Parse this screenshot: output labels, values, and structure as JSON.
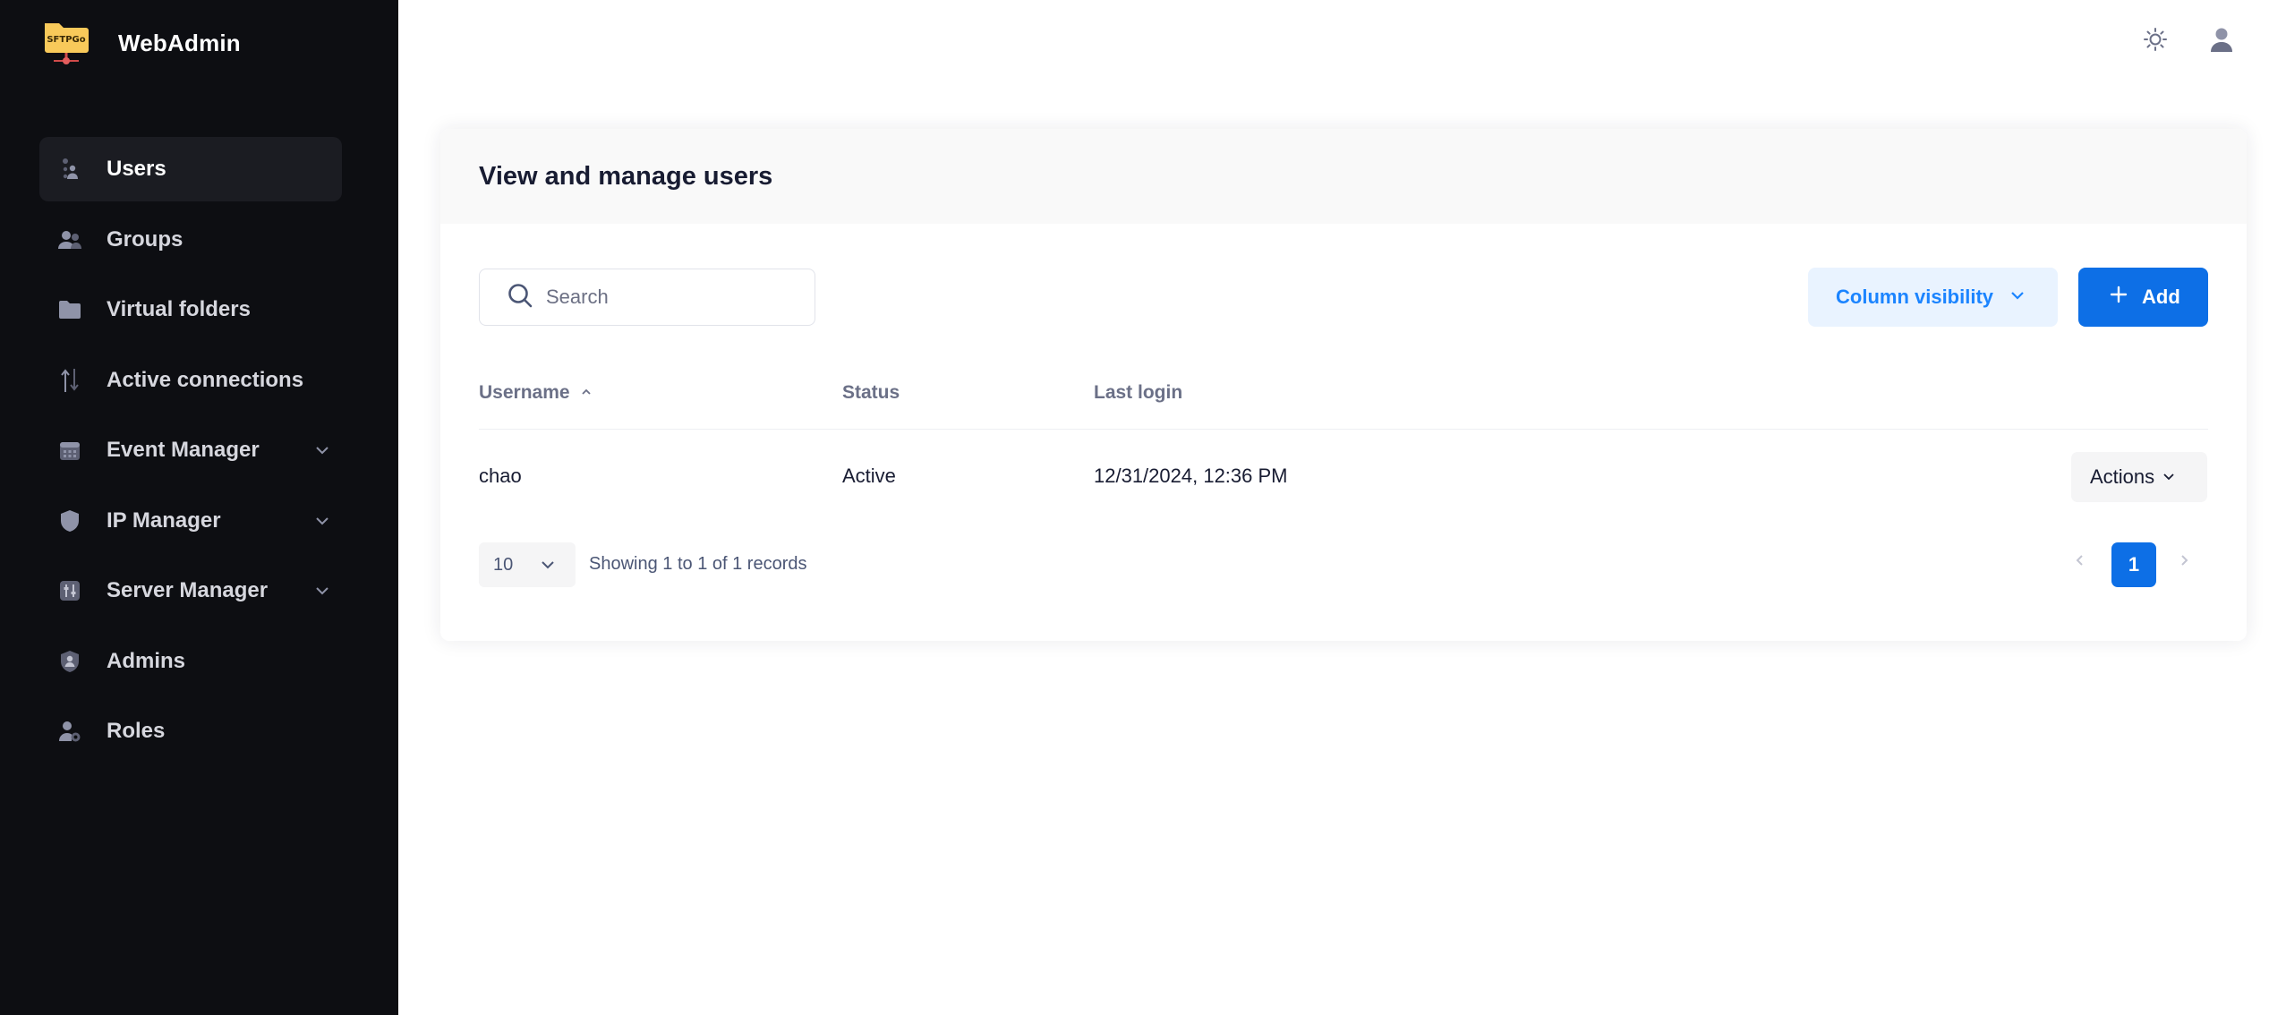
{
  "brand": {
    "logo_text": "SFTPGo",
    "title": "WebAdmin",
    "logo_color": "#f8c95a"
  },
  "sidebar": {
    "items": [
      {
        "label": "Users",
        "icon": "users-icon",
        "active": true,
        "expandable": false
      },
      {
        "label": "Groups",
        "icon": "groups-icon",
        "active": false,
        "expandable": false
      },
      {
        "label": "Virtual folders",
        "icon": "folder-icon",
        "active": false,
        "expandable": false
      },
      {
        "label": "Active connections",
        "icon": "transfer-arrows-icon",
        "active": false,
        "expandable": false
      },
      {
        "label": "Event Manager",
        "icon": "calendar-icon",
        "active": false,
        "expandable": true
      },
      {
        "label": "IP Manager",
        "icon": "shield-icon",
        "active": false,
        "expandable": true
      },
      {
        "label": "Server Manager",
        "icon": "sliders-icon",
        "active": false,
        "expandable": true
      },
      {
        "label": "Admins",
        "icon": "admin-shield-icon",
        "active": false,
        "expandable": false
      },
      {
        "label": "Roles",
        "icon": "user-gear-icon",
        "active": false,
        "expandable": false
      }
    ]
  },
  "topbar": {
    "theme_icon": "sun-icon",
    "user_icon": "user-icon"
  },
  "card": {
    "title": "View and manage users",
    "search_placeholder": "Search",
    "column_visibility_label": "Column visibility",
    "add_label": "Add",
    "columns": [
      "Username",
      "Status",
      "Last login"
    ],
    "rows": [
      {
        "username": "chao",
        "status": "Active",
        "last_login": "12/31/2024, 12:36 PM",
        "actions_label": "Actions"
      }
    ],
    "page_length": "10",
    "info": "Showing 1 to 1 of 1 records",
    "current_page": "1"
  },
  "colors": {
    "sidebar_bg": "#0d0e12",
    "primary": "#0d6fe6",
    "primary_light": "#e9f3ff"
  }
}
